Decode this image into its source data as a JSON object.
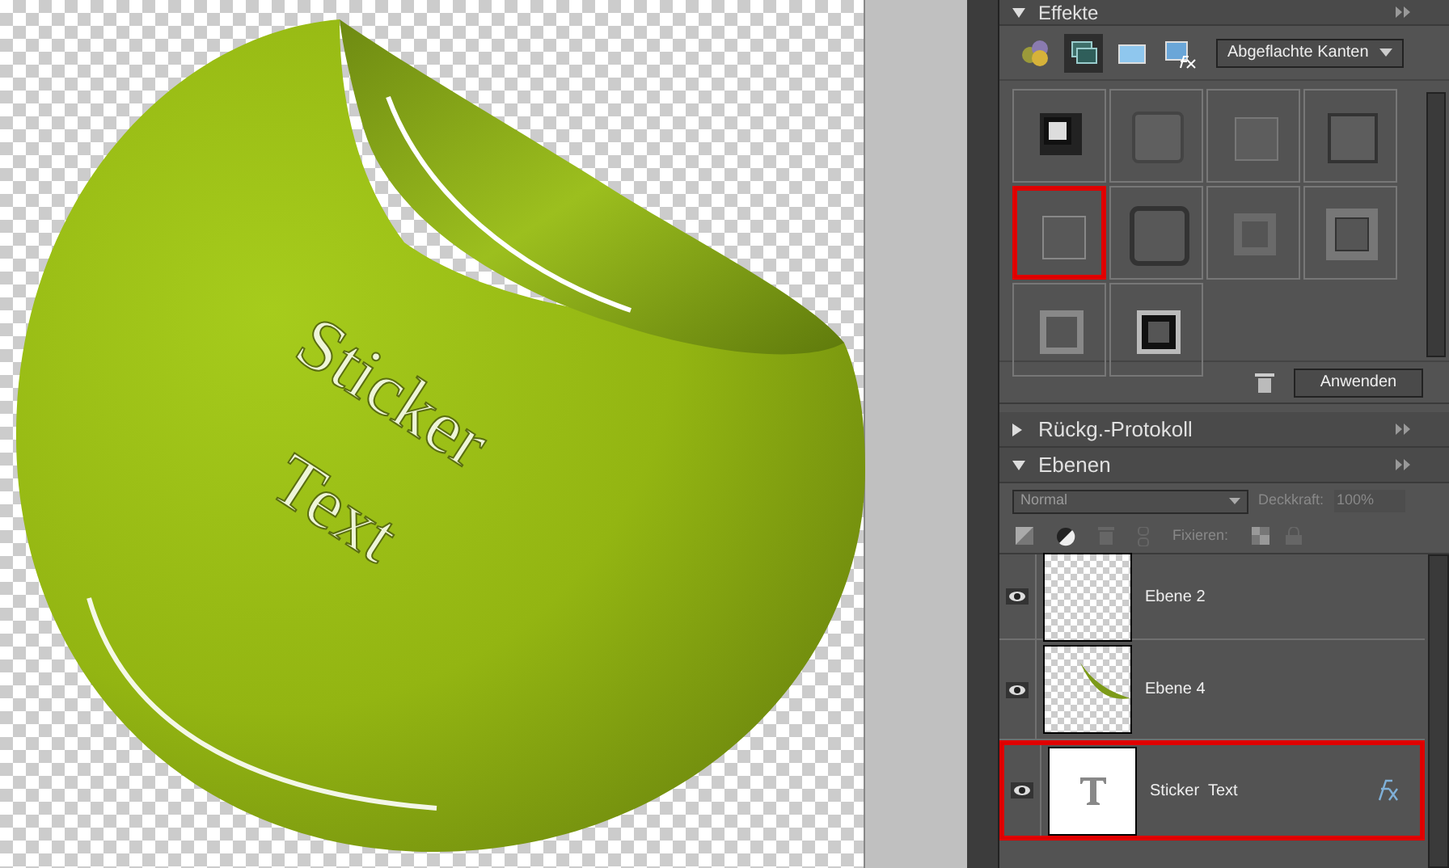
{
  "canvas": {
    "sticker_text": [
      "Sticker",
      "Text"
    ]
  },
  "effects_panel": {
    "title": "Effekte",
    "expanded": true,
    "category_dropdown": "Abgeflachte Kanten",
    "tabs": [
      {
        "kind": "styles",
        "selected": false
      },
      {
        "kind": "layer_styles",
        "selected": true
      },
      {
        "kind": "photo",
        "selected": false
      },
      {
        "kind": "fx",
        "selected": false
      }
    ],
    "thumbnails": [
      {
        "kind": "custom",
        "selected": false
      },
      {
        "kind": "soft",
        "selected": false
      },
      {
        "kind": "small",
        "selected": false
      },
      {
        "kind": "raised",
        "selected": false
      },
      {
        "kind": "thin",
        "selected": true
      },
      {
        "kind": "rounded",
        "selected": false
      },
      {
        "kind": "pillow",
        "selected": false
      },
      {
        "kind": "frame",
        "selected": false
      },
      {
        "kind": "inner",
        "selected": false
      },
      {
        "kind": "dark",
        "selected": false
      }
    ],
    "apply_button": "Anwenden"
  },
  "history_panel": {
    "title": "Rückg.-Protokoll",
    "expanded": false
  },
  "layers_panel": {
    "title": "Ebenen",
    "expanded": true,
    "blend_mode": "Normal",
    "opacity_label": "Deckkraft:",
    "opacity_value": "100%",
    "lock_label": "Fixieren:",
    "layers": [
      {
        "name": "Ebene 2",
        "kind": "empty",
        "visible": true,
        "selected": false,
        "has_effects": false
      },
      {
        "name": "Ebene 4",
        "kind": "shape",
        "visible": true,
        "selected": false,
        "has_effects": false
      },
      {
        "name": "Sticker  Text",
        "kind": "text",
        "visible": true,
        "selected": true,
        "has_effects": true
      }
    ]
  }
}
